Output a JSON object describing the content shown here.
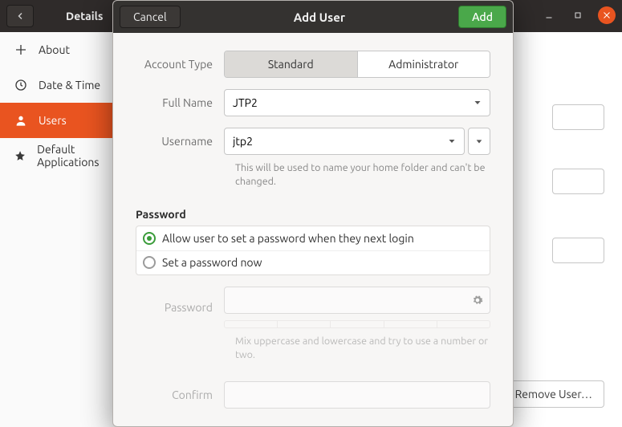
{
  "bg_window": {
    "back_title": "Details",
    "remove_user_label": "Remove User…"
  },
  "sidebar": {
    "items": [
      {
        "id": "about",
        "label": "About"
      },
      {
        "id": "datetime",
        "label": "Date & Time"
      },
      {
        "id": "users",
        "label": "Users"
      },
      {
        "id": "default-apps",
        "label": "Default Applications"
      }
    ]
  },
  "dialog": {
    "title": "Add User",
    "cancel_label": "Cancel",
    "add_label": "Add",
    "account_type_label": "Account Type",
    "account_type": {
      "standard_label": "Standard",
      "administrator_label": "Administrator",
      "selected": "standard"
    },
    "full_name_label": "Full Name",
    "full_name_value": "JTP2",
    "username_label": "Username",
    "username_value": "jtp2",
    "username_hint": "This will be used to name your home folder and can't be changed.",
    "password_section_label": "Password",
    "pw_option_later_label": "Allow user to set a password when they next login",
    "pw_option_now_label": "Set a password now",
    "pw_selected": "later",
    "password_label": "Password",
    "password_value": "",
    "password_hint": "Mix uppercase and lowercase and try to use a number or two.",
    "confirm_label": "Confirm",
    "confirm_value": ""
  }
}
